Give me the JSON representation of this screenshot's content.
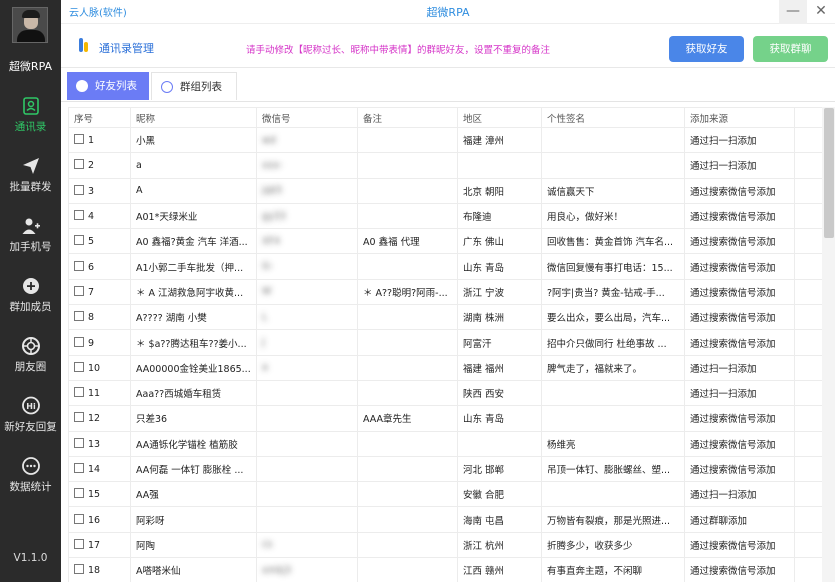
{
  "titlebar": {
    "account": "云人脉(软件)",
    "title": "超微RPA",
    "minimize": "—",
    "close": "✕"
  },
  "sidebar": {
    "brand": "超微RPA",
    "items": [
      {
        "label": "通讯录",
        "icon": "contacts-icon"
      },
      {
        "label": "批量群发",
        "icon": "send-icon"
      },
      {
        "label": "加手机号",
        "icon": "add-person-icon"
      },
      {
        "label": "群加成员",
        "icon": "add-group-member-icon"
      },
      {
        "label": "朋友圈",
        "icon": "camera-aperture-icon"
      },
      {
        "label": "新好友回复",
        "icon": "hi-bubble-icon"
      },
      {
        "label": "数据统计",
        "icon": "ellipsis-circle-icon"
      }
    ],
    "version": "V1.1.0"
  },
  "header": {
    "title": "通讯录管理",
    "notice": "请手动修改【昵称过长、昵称中带表情】的群昵好友，设置不重复的备注",
    "btn_get_friends": "获取好友",
    "btn_get_groups": "获取群聊"
  },
  "tabs": [
    {
      "label": "好友列表"
    },
    {
      "label": "群组列表"
    }
  ],
  "colors": {
    "sidebar_bg": "#2b2b2b",
    "active_green": "#2fc766",
    "accent_blue": "#4a86e8",
    "tab_purple": "#6b7cf5",
    "notice_magenta": "#d534c8"
  },
  "table": {
    "columns": [
      "序号",
      "昵称",
      "微信号",
      "备注",
      "地区",
      "个性签名",
      "添加来源"
    ],
    "rows": [
      [
        "1",
        "小黑",
        "wd",
        "",
        "福建 漳州",
        "",
        "通过扫一扫添加"
      ],
      [
        "2",
        "a",
        "xxx-",
        "",
        "",
        "",
        "通过扫一扫添加"
      ],
      [
        "3",
        "A",
        "jqk5",
        "",
        "北京 朝阳",
        "诚信赢天下",
        "通过搜索微信号添加"
      ],
      [
        "4",
        "A01*天绿米业",
        "gy33",
        "",
        "布隆迪",
        "用良心，做好米！",
        "通过搜索微信号添加"
      ],
      [
        "5",
        "A0 鑫福?黄金 汽车 洋酒...",
        "XF4",
        "A0 鑫福  代理",
        "广东 佛山",
        "回收售售：黄金首饰 汽车名...",
        "通过搜索微信号添加"
      ],
      [
        "6",
        "A1小郭二手车批发（押...",
        "G-",
        "",
        "山东 青岛",
        "微信回复慢有事打电话：15...",
        "通过搜索微信号添加"
      ],
      [
        "7",
        "＊  A 江湖救急阿宇收黄...",
        "W",
        "＊  A??聪明?阿雨-...",
        "浙江 宁波",
        "?阿宇|贵当? 黄金-钻戒-手...",
        "通过搜索微信号添加"
      ],
      [
        "8",
        "A???? 湖南  小樊",
        "L",
        "",
        "湖南 株洲",
        "要么出众，要么出局，汽车...",
        "通过搜索微信号添加"
      ],
      [
        "9",
        "＊ $a??腾达租车??姜小...",
        "J",
        "",
        "阿富汗",
        "招中介只做同行 杜绝事故 ...",
        "通过搜索微信号添加"
      ],
      [
        "10",
        "AA00000金铨美业1865...",
        "a",
        "",
        "福建 福州",
        "脾气走了，福就来了。",
        "通过扫一扫添加"
      ],
      [
        "11",
        "Aaa??西城婚车租赁",
        "",
        "",
        "陕西 西安",
        "",
        "通过扫一扫添加"
      ],
      [
        "12",
        "只差36",
        "",
        "AAA章先生",
        "山东 青岛",
        "",
        "通过搜索微信号添加"
      ],
      [
        "13",
        "AA通铄化学锚栓 植筋胶",
        "",
        "",
        "",
        "杨维亮",
        "通过搜索微信号添加"
      ],
      [
        "14",
        "AA何磊 一体钉  膨胀栓 ...",
        "",
        "",
        "河北 邯郸",
        "吊顶一体钉、膨胀螺丝、塑...",
        "通过搜索微信号添加"
      ],
      [
        "15",
        "AA强",
        "",
        "",
        "安徽 合肥",
        "",
        "通过扫一扫添加"
      ],
      [
        "16",
        "阿彩呀",
        "",
        "",
        "海南 屯昌",
        "万物皆有裂痕，那是光照进...",
        "通过群聊添加"
      ],
      [
        "17",
        "阿陶",
        "cs",
        "",
        "浙江 杭州",
        "折腾多少，收获多少",
        "通过搜索微信号添加"
      ],
      [
        "18",
        "A嗒嗒米仙",
        "xmkj3",
        "",
        "江西 赣州",
        "有事直奔主题，不闲聊",
        "通过搜索微信号添加"
      ]
    ]
  }
}
